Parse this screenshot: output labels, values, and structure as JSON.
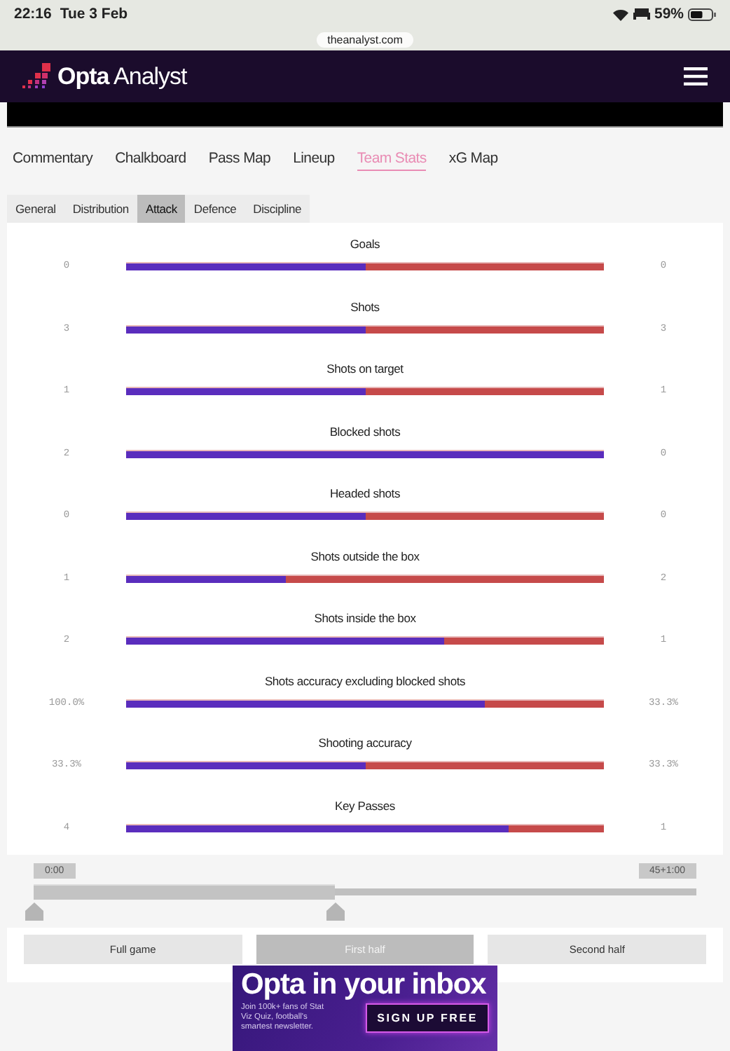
{
  "status_bar": {
    "time": "22:16",
    "date": "Tue 3 Feb",
    "battery": "59%"
  },
  "address": "theanalyst.com",
  "header": {
    "logo_bold": "Opta",
    "logo_light": "Analyst"
  },
  "tabs": [
    {
      "label": "Commentary",
      "selected": false
    },
    {
      "label": "Chalkboard",
      "selected": false
    },
    {
      "label": "Pass Map",
      "selected": false
    },
    {
      "label": "Lineup",
      "selected": false
    },
    {
      "label": "Team Stats",
      "selected": true
    },
    {
      "label": "xG Map",
      "selected": false
    }
  ],
  "subtabs": [
    {
      "label": "General",
      "selected": false
    },
    {
      "label": "Distribution",
      "selected": false
    },
    {
      "label": "Attack",
      "selected": true
    },
    {
      "label": "Defence",
      "selected": false
    },
    {
      "label": "Discipline",
      "selected": false
    }
  ],
  "stats": [
    {
      "name": "Goals",
      "home": "0",
      "away": "0",
      "level": 0.5
    },
    {
      "name": "Shots",
      "home": "3",
      "away": "3",
      "level": 0.5
    },
    {
      "name": "Shots on target",
      "home": "1",
      "away": "1",
      "level": 0.5
    },
    {
      "name": "Blocked shots",
      "home": "2",
      "away": "0",
      "level": 1
    },
    {
      "name": "Headed shots",
      "home": "0",
      "away": "0",
      "level": 0.5
    },
    {
      "name": "Shots outside the box",
      "home": "1",
      "away": "2",
      "level": 0.333
    },
    {
      "name": "Shots inside the box",
      "home": "2",
      "away": "1",
      "level": 0.667
    },
    {
      "name": "Shots accuracy excluding blocked shots",
      "home": "100.0%",
      "away": "33.3%",
      "level": 0.75
    },
    {
      "name": "Shooting accuracy",
      "home": "33.3%",
      "away": "33.3%",
      "level": 0.5
    },
    {
      "name": "Key Passes",
      "home": "4",
      "away": "1",
      "level": 0.8
    }
  ],
  "timeline": {
    "start": "0:00",
    "end": "45+1:00",
    "level": 0.455
  },
  "periods": [
    {
      "label": "Full game",
      "selected": false
    },
    {
      "label": "First half",
      "selected": true
    },
    {
      "label": "Second half",
      "selected": false
    }
  ],
  "ad": {
    "title": "Opta in your inbox",
    "text": "Join 100k+ fans of Stat Viz Quiz, football's smartest newsletter.",
    "button": "SIGN UP FREE"
  }
}
